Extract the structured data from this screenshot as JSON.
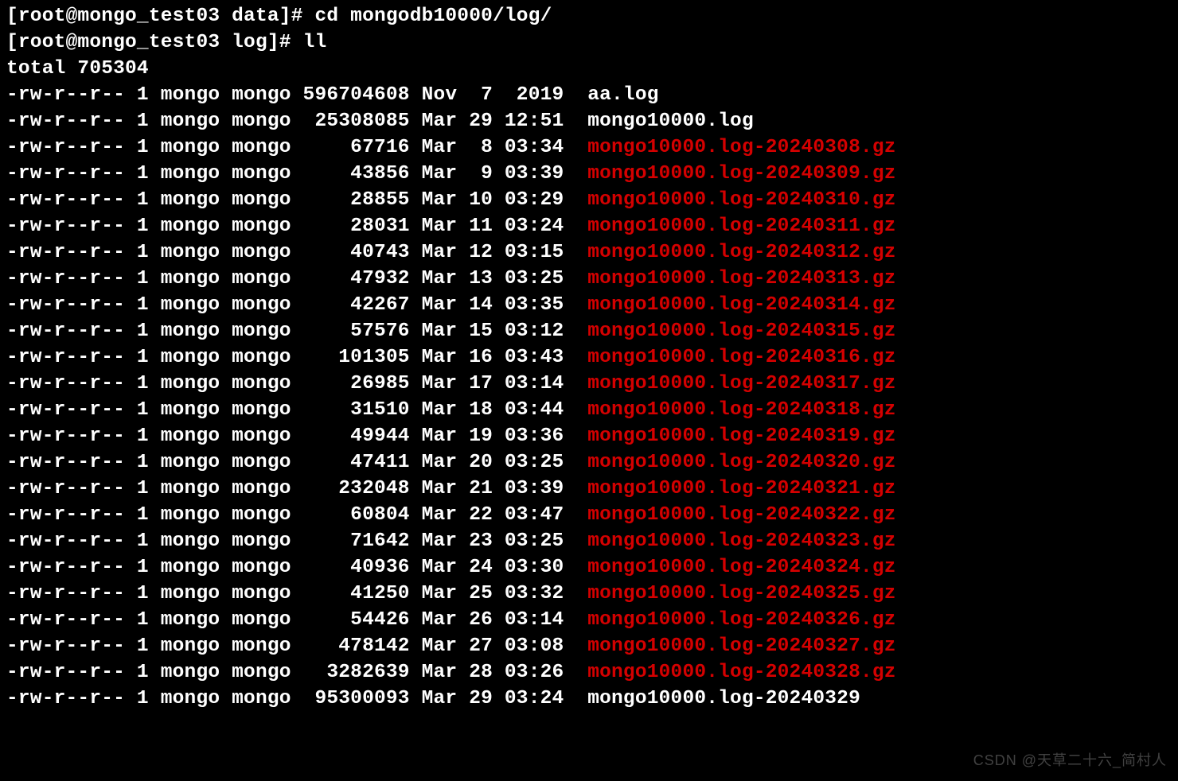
{
  "prompts": [
    {
      "userhost": "[root@mongo_test03 data]# ",
      "cmd": "cd mongodb10000/log/"
    },
    {
      "userhost": "[root@mongo_test03 log]# ",
      "cmd": "ll"
    }
  ],
  "total_line": "total 705304",
  "files": [
    {
      "perms": "-rw-r--r--",
      "links": "1",
      "owner": "mongo",
      "group": "mongo",
      "size": "596704608",
      "month": "Nov",
      "day": " 7",
      "timeyear": " 2019",
      "name": "aa.log",
      "gz": false
    },
    {
      "perms": "-rw-r--r--",
      "links": "1",
      "owner": "mongo",
      "group": "mongo",
      "size": "25308085",
      "month": "Mar",
      "day": "29",
      "timeyear": "12:51",
      "name": "mongo10000.log",
      "gz": false
    },
    {
      "perms": "-rw-r--r--",
      "links": "1",
      "owner": "mongo",
      "group": "mongo",
      "size": "67716",
      "month": "Mar",
      "day": " 8",
      "timeyear": "03:34",
      "name": "mongo10000.log-20240308.gz",
      "gz": true
    },
    {
      "perms": "-rw-r--r--",
      "links": "1",
      "owner": "mongo",
      "group": "mongo",
      "size": "43856",
      "month": "Mar",
      "day": " 9",
      "timeyear": "03:39",
      "name": "mongo10000.log-20240309.gz",
      "gz": true
    },
    {
      "perms": "-rw-r--r--",
      "links": "1",
      "owner": "mongo",
      "group": "mongo",
      "size": "28855",
      "month": "Mar",
      "day": "10",
      "timeyear": "03:29",
      "name": "mongo10000.log-20240310.gz",
      "gz": true
    },
    {
      "perms": "-rw-r--r--",
      "links": "1",
      "owner": "mongo",
      "group": "mongo",
      "size": "28031",
      "month": "Mar",
      "day": "11",
      "timeyear": "03:24",
      "name": "mongo10000.log-20240311.gz",
      "gz": true
    },
    {
      "perms": "-rw-r--r--",
      "links": "1",
      "owner": "mongo",
      "group": "mongo",
      "size": "40743",
      "month": "Mar",
      "day": "12",
      "timeyear": "03:15",
      "name": "mongo10000.log-20240312.gz",
      "gz": true
    },
    {
      "perms": "-rw-r--r--",
      "links": "1",
      "owner": "mongo",
      "group": "mongo",
      "size": "47932",
      "month": "Mar",
      "day": "13",
      "timeyear": "03:25",
      "name": "mongo10000.log-20240313.gz",
      "gz": true
    },
    {
      "perms": "-rw-r--r--",
      "links": "1",
      "owner": "mongo",
      "group": "mongo",
      "size": "42267",
      "month": "Mar",
      "day": "14",
      "timeyear": "03:35",
      "name": "mongo10000.log-20240314.gz",
      "gz": true
    },
    {
      "perms": "-rw-r--r--",
      "links": "1",
      "owner": "mongo",
      "group": "mongo",
      "size": "57576",
      "month": "Mar",
      "day": "15",
      "timeyear": "03:12",
      "name": "mongo10000.log-20240315.gz",
      "gz": true
    },
    {
      "perms": "-rw-r--r--",
      "links": "1",
      "owner": "mongo",
      "group": "mongo",
      "size": "101305",
      "month": "Mar",
      "day": "16",
      "timeyear": "03:43",
      "name": "mongo10000.log-20240316.gz",
      "gz": true
    },
    {
      "perms": "-rw-r--r--",
      "links": "1",
      "owner": "mongo",
      "group": "mongo",
      "size": "26985",
      "month": "Mar",
      "day": "17",
      "timeyear": "03:14",
      "name": "mongo10000.log-20240317.gz",
      "gz": true
    },
    {
      "perms": "-rw-r--r--",
      "links": "1",
      "owner": "mongo",
      "group": "mongo",
      "size": "31510",
      "month": "Mar",
      "day": "18",
      "timeyear": "03:44",
      "name": "mongo10000.log-20240318.gz",
      "gz": true
    },
    {
      "perms": "-rw-r--r--",
      "links": "1",
      "owner": "mongo",
      "group": "mongo",
      "size": "49944",
      "month": "Mar",
      "day": "19",
      "timeyear": "03:36",
      "name": "mongo10000.log-20240319.gz",
      "gz": true
    },
    {
      "perms": "-rw-r--r--",
      "links": "1",
      "owner": "mongo",
      "group": "mongo",
      "size": "47411",
      "month": "Mar",
      "day": "20",
      "timeyear": "03:25",
      "name": "mongo10000.log-20240320.gz",
      "gz": true
    },
    {
      "perms": "-rw-r--r--",
      "links": "1",
      "owner": "mongo",
      "group": "mongo",
      "size": "232048",
      "month": "Mar",
      "day": "21",
      "timeyear": "03:39",
      "name": "mongo10000.log-20240321.gz",
      "gz": true
    },
    {
      "perms": "-rw-r--r--",
      "links": "1",
      "owner": "mongo",
      "group": "mongo",
      "size": "60804",
      "month": "Mar",
      "day": "22",
      "timeyear": "03:47",
      "name": "mongo10000.log-20240322.gz",
      "gz": true
    },
    {
      "perms": "-rw-r--r--",
      "links": "1",
      "owner": "mongo",
      "group": "mongo",
      "size": "71642",
      "month": "Mar",
      "day": "23",
      "timeyear": "03:25",
      "name": "mongo10000.log-20240323.gz",
      "gz": true
    },
    {
      "perms": "-rw-r--r--",
      "links": "1",
      "owner": "mongo",
      "group": "mongo",
      "size": "40936",
      "month": "Mar",
      "day": "24",
      "timeyear": "03:30",
      "name": "mongo10000.log-20240324.gz",
      "gz": true
    },
    {
      "perms": "-rw-r--r--",
      "links": "1",
      "owner": "mongo",
      "group": "mongo",
      "size": "41250",
      "month": "Mar",
      "day": "25",
      "timeyear": "03:32",
      "name": "mongo10000.log-20240325.gz",
      "gz": true
    },
    {
      "perms": "-rw-r--r--",
      "links": "1",
      "owner": "mongo",
      "group": "mongo",
      "size": "54426",
      "month": "Mar",
      "day": "26",
      "timeyear": "03:14",
      "name": "mongo10000.log-20240326.gz",
      "gz": true
    },
    {
      "perms": "-rw-r--r--",
      "links": "1",
      "owner": "mongo",
      "group": "mongo",
      "size": "478142",
      "month": "Mar",
      "day": "27",
      "timeyear": "03:08",
      "name": "mongo10000.log-20240327.gz",
      "gz": true
    },
    {
      "perms": "-rw-r--r--",
      "links": "1",
      "owner": "mongo",
      "group": "mongo",
      "size": "3282639",
      "month": "Mar",
      "day": "28",
      "timeyear": "03:26",
      "name": "mongo10000.log-20240328.gz",
      "gz": true
    },
    {
      "perms": "-rw-r--r--",
      "links": "1",
      "owner": "mongo",
      "group": "mongo",
      "size": "95300093",
      "month": "Mar",
      "day": "29",
      "timeyear": "03:24",
      "name": "mongo10000.log-20240329",
      "gz": false
    }
  ],
  "watermark": "CSDN @天草二十六_简村人"
}
